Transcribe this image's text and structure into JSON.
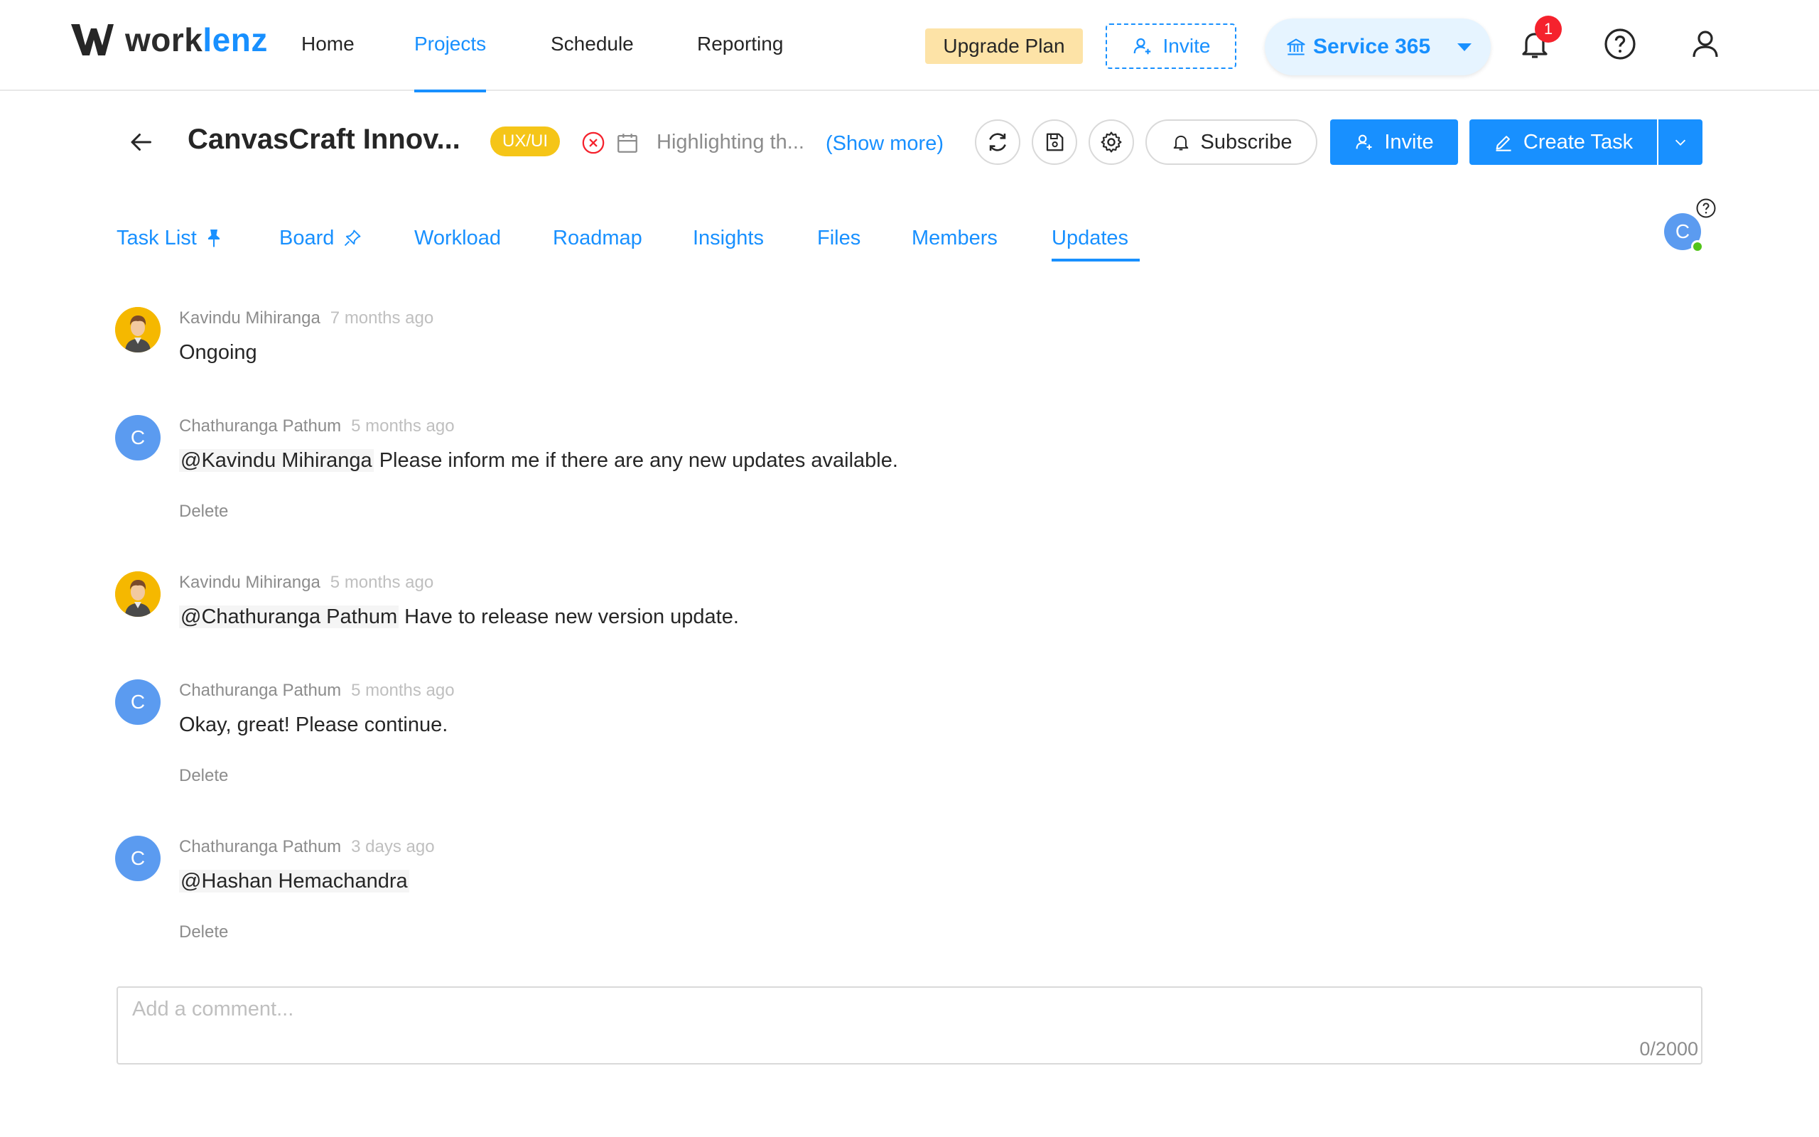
{
  "brand": {
    "name_part1": "work",
    "name_part2": "lenz"
  },
  "topnav": {
    "items": [
      {
        "label": "Home",
        "active": false
      },
      {
        "label": "Projects",
        "active": true
      },
      {
        "label": "Schedule",
        "active": false
      },
      {
        "label": "Reporting",
        "active": false
      }
    ],
    "upgrade_label": "Upgrade Plan",
    "invite_label": "Invite",
    "org_name": "Service 365",
    "notification_count": "1"
  },
  "project": {
    "title": "CanvasCraft Innov...",
    "tag": "UX/UI",
    "description": "Highlighting th...",
    "show_more": "(Show more)",
    "subscribe_label": "Subscribe",
    "invite_label": "Invite",
    "create_task_label": "Create Task"
  },
  "tabs": [
    {
      "label": "Task List",
      "pin": "pinned"
    },
    {
      "label": "Board",
      "pin": "unpinned"
    },
    {
      "label": "Workload"
    },
    {
      "label": "Roadmap"
    },
    {
      "label": "Insights"
    },
    {
      "label": "Files"
    },
    {
      "label": "Members"
    },
    {
      "label": "Updates",
      "active": true
    }
  ],
  "current_user": {
    "initial": "C"
  },
  "comments": [
    {
      "author": "Kavindu Mihiranga",
      "time": "7 months ago",
      "avatar": "photo",
      "mention": "",
      "text": "Ongoing",
      "delete_label": ""
    },
    {
      "author": "Chathuranga Pathum",
      "time": "5 months ago",
      "avatar": "C",
      "mention": "@Kavindu Mihiranga",
      "text": " Please inform me if there are any new updates available.",
      "delete_label": "Delete"
    },
    {
      "author": "Kavindu Mihiranga",
      "time": "5 months ago",
      "avatar": "photo",
      "mention": "@Chathuranga Pathum",
      "text": " Have to release new version update.",
      "delete_label": ""
    },
    {
      "author": "Chathuranga Pathum",
      "time": "5 months ago",
      "avatar": "C",
      "mention": "",
      "text": "Okay, great! Please continue.",
      "delete_label": "Delete"
    },
    {
      "author": "Chathuranga Pathum",
      "time": "3 days ago",
      "avatar": "C",
      "mention": "@Hashan Hemachandra",
      "text": "",
      "delete_label": "Delete"
    }
  ],
  "comment_input": {
    "placeholder": "Add a comment...",
    "counter": "0/2000"
  },
  "colors": {
    "primary": "#1890ff",
    "tag": "#f5c518",
    "upgrade": "#fde3a7",
    "badge": "#f5222d",
    "online": "#52c41a"
  }
}
